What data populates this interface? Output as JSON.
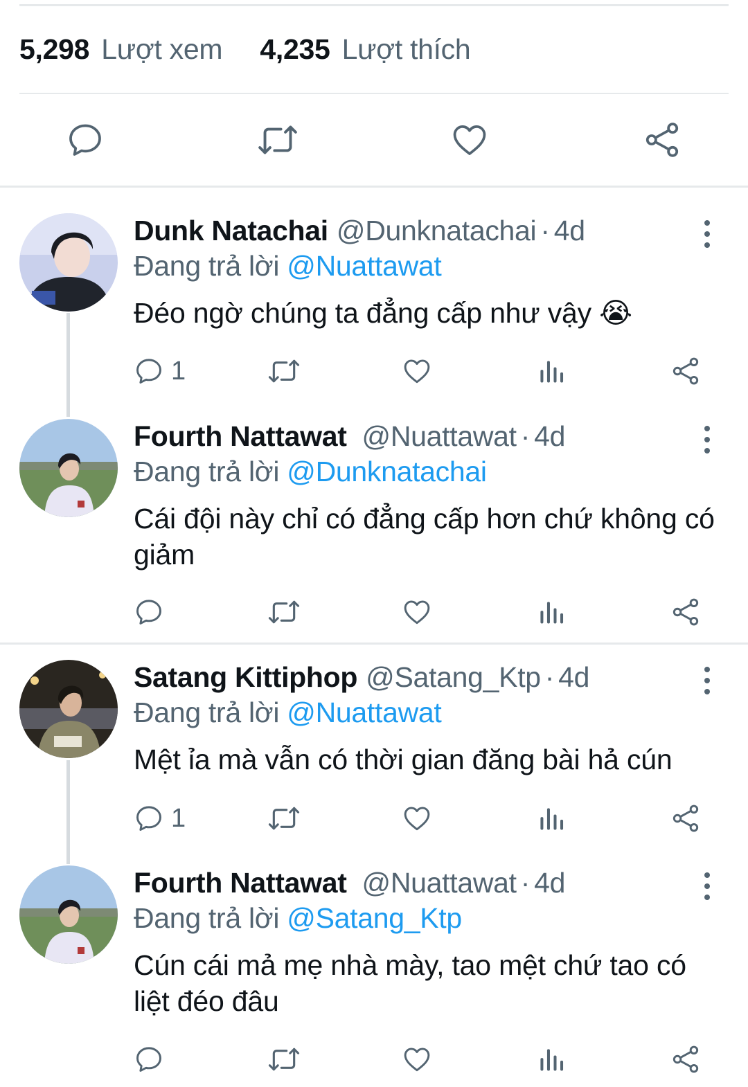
{
  "stats": {
    "views_count": "5,298",
    "views_label": "Lượt xem",
    "likes_count": "4,235",
    "likes_label": "Lượt thích"
  },
  "action_bar": {
    "icons": [
      "reply-icon",
      "retweet-icon",
      "like-icon",
      "share-icon"
    ]
  },
  "replies": [
    {
      "name": "Dunk Natachai",
      "handle": "@Dunknatachai",
      "time": "4d",
      "reply_prefix": "Đang trả lời",
      "reply_to": "@Nuattawat",
      "text": "Đéo ngờ chúng ta đẳng cấp như vậy 😭",
      "reply_count": "1"
    },
    {
      "name": "Fourth Nattawat",
      "handle": "@Nuattawat",
      "time": "4d",
      "reply_prefix": "Đang trả lời",
      "reply_to": "@Dunknatachai",
      "text": "Cái đội này chỉ có đẳng cấp hơn chứ không có giảm",
      "reply_count": ""
    },
    {
      "name": "Satang Kittiphop",
      "handle": "@Satang_Ktp",
      "time": "4d",
      "reply_prefix": "Đang trả lời",
      "reply_to": "@Nuattawat",
      "text": "Mệt ỉa mà vẫn có thời gian đăng bài hả cún",
      "reply_count": "1"
    },
    {
      "name": "Fourth Nattawat",
      "handle": "@Nuattawat",
      "time": "4d",
      "reply_prefix": "Đang trả lời",
      "reply_to": "@Satang_Ktp",
      "text": "Cún cái mả mẹ nhà mày, tao mệt chứ tao có liệt đéo đâu",
      "reply_count": ""
    }
  ],
  "colors": {
    "text": "#0f1419",
    "secondary": "#536471",
    "link": "#1d9bf0",
    "divider": "#e6e9eb"
  }
}
